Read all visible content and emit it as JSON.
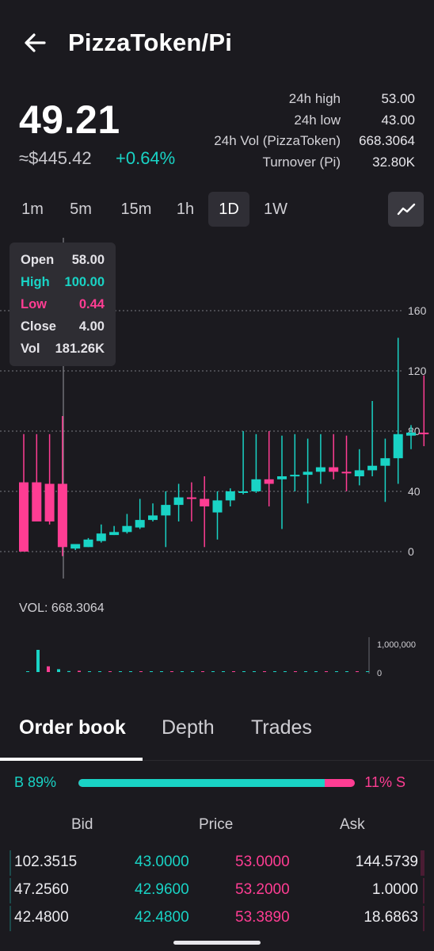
{
  "header": {
    "title": "PizzaToken/Pi"
  },
  "price": {
    "last": "49.21",
    "usd": "≈$445.42",
    "change": "+0.64%"
  },
  "stats": [
    {
      "label": "24h high",
      "value": "53.00"
    },
    {
      "label": "24h low",
      "value": "43.00"
    },
    {
      "label": "24h Vol (PizzaToken)",
      "value": "668.3064"
    },
    {
      "label": "Turnover (Pi)",
      "value": "32.80K"
    }
  ],
  "intervals": [
    "1m",
    "5m",
    "15m",
    "1h",
    "1D",
    "1W"
  ],
  "active_interval": "1D",
  "tooltip": {
    "open_label": "Open",
    "open": "58.00",
    "high_label": "High",
    "high": "100.00",
    "low_label": "Low",
    "low": "0.44",
    "close_label": "Close",
    "close": "4.00",
    "vol_label": "Vol",
    "vol": "181.26K"
  },
  "volume": {
    "label": "VOL: 668.3064"
  },
  "colors": {
    "up": "#19d3c5",
    "down": "#ff3d93",
    "background": "#1b1a1f"
  },
  "chart_data": {
    "type": "candlestick",
    "y_ticks": [
      "160",
      "120",
      "80",
      "40",
      "0"
    ],
    "ylim": [
      0,
      160
    ],
    "candles": [
      {
        "o": 46,
        "h": 78,
        "l": 0,
        "c": 0
      },
      {
        "o": 46,
        "h": 78,
        "l": 20,
        "c": 20
      },
      {
        "o": 45,
        "h": 78,
        "l": 18,
        "c": 20
      },
      {
        "o": 45,
        "h": 90,
        "l": -3,
        "c": 3
      },
      {
        "o": 2,
        "h": 5,
        "l": 1,
        "c": 5
      },
      {
        "o": 3,
        "h": 9,
        "l": 3,
        "c": 8
      },
      {
        "o": 7,
        "h": 18,
        "l": 6,
        "c": 12
      },
      {
        "o": 11,
        "h": 17,
        "l": 11,
        "c": 13
      },
      {
        "o": 13,
        "h": 25,
        "l": 12,
        "c": 17
      },
      {
        "o": 16,
        "h": 35,
        "l": 15,
        "c": 21
      },
      {
        "o": 21,
        "h": 32,
        "l": 20,
        "c": 24
      },
      {
        "o": 24,
        "h": 40,
        "l": 3,
        "c": 31
      },
      {
        "o": 31,
        "h": 45,
        "l": 20,
        "c": 36
      },
      {
        "o": 36,
        "h": 46,
        "l": 20,
        "c": 35
      },
      {
        "o": 35,
        "h": 50,
        "l": 3,
        "c": 30
      },
      {
        "o": 26,
        "h": 40,
        "l": 8,
        "c": 34
      },
      {
        "o": 34,
        "h": 42,
        "l": 30,
        "c": 40
      },
      {
        "o": 40,
        "h": 80,
        "l": 38,
        "c": 40
      },
      {
        "o": 40,
        "h": 78,
        "l": 39,
        "c": 48
      },
      {
        "o": 48,
        "h": 80,
        "l": 30,
        "c": 45
      },
      {
        "o": 48,
        "h": 77,
        "l": 15,
        "c": 50
      },
      {
        "o": 50,
        "h": 78,
        "l": 40,
        "c": 51
      },
      {
        "o": 51,
        "h": 75,
        "l": 32,
        "c": 53
      },
      {
        "o": 53,
        "h": 78,
        "l": 45,
        "c": 56
      },
      {
        "o": 56,
        "h": 78,
        "l": 48,
        "c": 53
      },
      {
        "o": 53,
        "h": 77,
        "l": 40,
        "c": 52
      },
      {
        "o": 50,
        "h": 68,
        "l": 44,
        "c": 54
      },
      {
        "o": 54,
        "h": 100,
        "l": 50,
        "c": 57
      },
      {
        "o": 57,
        "h": 75,
        "l": 33,
        "c": 62
      },
      {
        "o": 62,
        "h": 142,
        "l": 45,
        "c": 78
      },
      {
        "o": 77,
        "h": 84,
        "l": 68,
        "c": 79
      },
      {
        "o": 79,
        "h": 117,
        "l": 70,
        "c": 78
      }
    ],
    "volume_ticks": [
      "1,000,000",
      "0"
    ],
    "volume_max": 1000000,
    "volumes": [
      0,
      700000,
      180000,
      90000,
      30000,
      40000,
      20000,
      5000,
      8000,
      6000,
      5000,
      4000,
      5000,
      3000,
      4000,
      3000,
      2000,
      2000,
      3000,
      2000,
      2000,
      10000,
      2000,
      2000,
      2000,
      20000,
      2000,
      3000,
      2000,
      2000,
      3000,
      2000,
      2000,
      2000
    ]
  },
  "tabs": [
    "Order book",
    "Depth",
    "Trades"
  ],
  "ratio": {
    "buy_label": "B 89%",
    "sell_label": "11% S",
    "buy_fraction": 0.89
  },
  "orderbook": {
    "headers": {
      "bid": "Bid",
      "price": "Price",
      "ask": "Ask"
    },
    "rows": [
      {
        "bid": "102.3515",
        "bid_price": "43.0000",
        "ask_price": "53.0000",
        "ask": "144.5739",
        "bid_depth": 0.004,
        "ask_depth": 0.01
      },
      {
        "bid": "47.2560",
        "bid_price": "42.9600",
        "ask_price": "53.2000",
        "ask": "1.0000",
        "bid_depth": 0.0,
        "ask_depth": 0.0
      },
      {
        "bid": "42.4800",
        "bid_price": "42.4800",
        "ask_price": "53.3890",
        "ask": "18.6863",
        "bid_depth": 0.004,
        "ask_depth": 0.0
      }
    ]
  }
}
